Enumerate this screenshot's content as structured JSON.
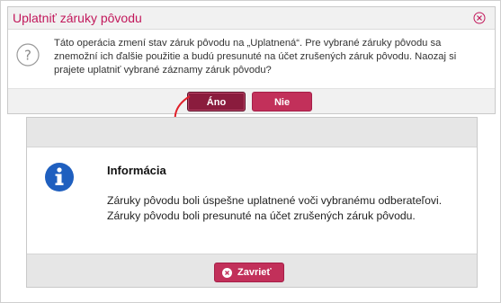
{
  "confirm_dialog": {
    "title": "Uplatniť záruky pôvodu",
    "message": "Táto operácia zmení stav záruk pôvodu na „Uplatnená“. Pre vybrané záruky pôvodu sa znemožní ich ďalšie použitie a budú presunuté na účet zrušených záruk pôvodu. Naozaj si prajete uplatniť vybrané záznamy záruk pôvodu?",
    "yes_label": "Áno",
    "no_label": "Nie"
  },
  "info_dialog": {
    "heading": "Informácia",
    "message": "Záruky pôvodu boli úspešne uplatnené voči vybranému odberateľovi. Záruky pôvodu boli presunuté na účet zrušených záruk pôvodu.",
    "close_label": "Zavrieť"
  },
  "colors": {
    "accent": "#c2305a",
    "accent_dark": "#8a1c3d",
    "title": "#c2185b",
    "info_icon": "#1f5fbf",
    "arrow": "#e0202a"
  }
}
